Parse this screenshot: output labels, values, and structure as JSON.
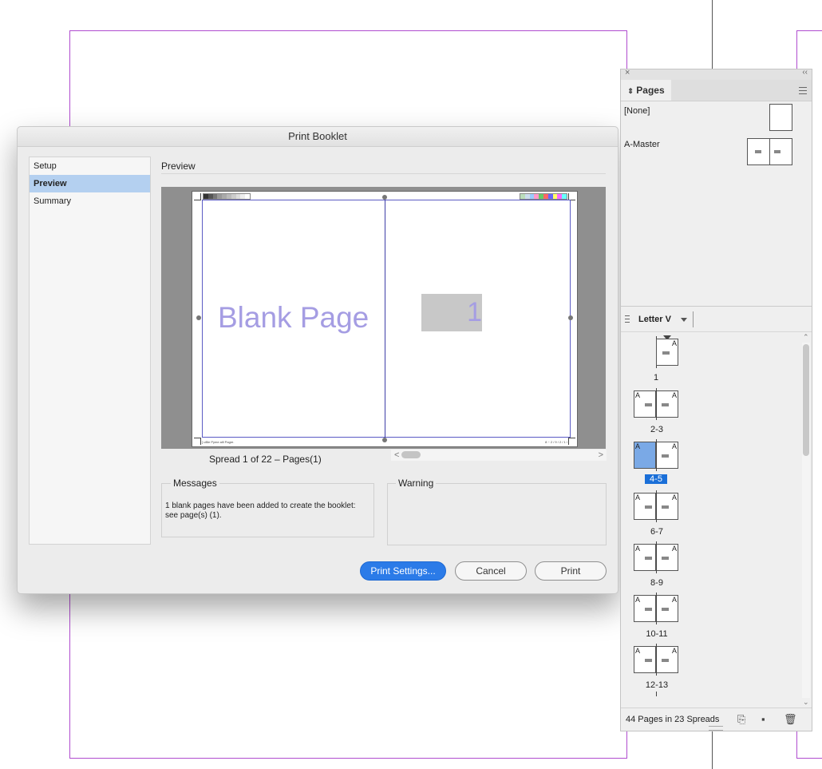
{
  "dialog": {
    "title": "Print Booklet",
    "sidebar": [
      {
        "label": "Setup",
        "selected": false
      },
      {
        "label": "Preview",
        "selected": true
      },
      {
        "label": "Summary",
        "selected": false
      }
    ],
    "section_title": "Preview",
    "preview": {
      "blank_page_text": "Blank Page",
      "page_number": "1",
      "slug_left": "[ uBle  Pyme  alll  Pagre. ",
      "slug_right": "8 ~ 2 / 9 / 2 / 1 /"
    },
    "spread_label": "Spread 1 of 22 – Pages(1)",
    "messages_title": "Messages",
    "messages_text": "1 blank pages have been added to create the booklet: see page(s) (1).",
    "warning_title": "Warning",
    "warning_text": "",
    "buttons": {
      "print_settings": "Print Settings...",
      "cancel": "Cancel",
      "print": "Print"
    }
  },
  "pages_panel": {
    "tab_label": "Pages",
    "masters": [
      {
        "label": "[None]"
      },
      {
        "label": "A-Master"
      }
    ],
    "size_label": "Letter V",
    "spreads": [
      {
        "label": "1",
        "left_a": "",
        "right_a": "A",
        "selected": false
      },
      {
        "label": "2-3",
        "left_a": "A",
        "right_a": "A",
        "selected": false
      },
      {
        "label": "4-5",
        "left_a": "A",
        "right_a": "A",
        "selected": true
      },
      {
        "label": "6-7",
        "left_a": "A",
        "right_a": "A",
        "selected": false
      },
      {
        "label": "8-9",
        "left_a": "A",
        "right_a": "A",
        "selected": false
      },
      {
        "label": "10-11",
        "left_a": "A",
        "right_a": "A",
        "selected": false
      },
      {
        "label": "12-13",
        "left_a": "A",
        "right_a": "A",
        "selected": false
      }
    ],
    "footer_label": "44 Pages in 23 Spreads",
    "accent_color": "#1a6fd8",
    "selection_color": "#7aa9e6"
  },
  "colors": {
    "guide": "#b04ccf",
    "primary_button": "#2b7be8",
    "placeholder_text": "#a59de3"
  }
}
